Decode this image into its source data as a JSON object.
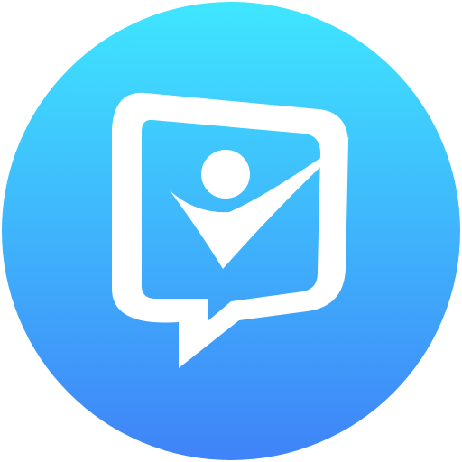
{
  "app_icon": {
    "icon": "chat-bubble-checkmark-person-icon",
    "shape": "circle",
    "colors": {
      "gradient_top": "#3FE6FF",
      "gradient_bottom": "#3F83F8",
      "glyph": "#FFFFFF",
      "canvas": "#FFFFFF"
    }
  }
}
